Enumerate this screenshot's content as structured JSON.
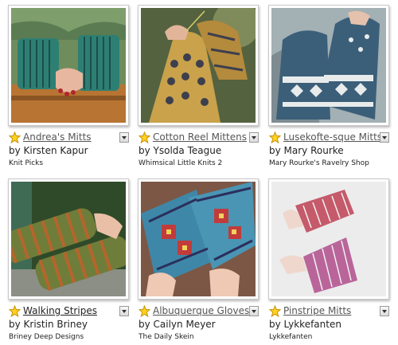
{
  "patterns": [
    {
      "title": "Andrea's Mitts",
      "author": "by Kirsten Kapur",
      "source": "Knit Picks",
      "image_alt": "green striped fingerless mitts",
      "colors": {
        "bg": "#6b7e58",
        "knit": "#2e7f73",
        "stripe": "#1c4e4a",
        "skin": "#e7b7a0"
      }
    },
    {
      "title": "Cotton Reel Mittens",
      "author": "by Ysolda Teague",
      "source": "Whimsical Little Knits 2",
      "image_alt": "mustard and grey colorwork mittens",
      "colors": {
        "bg": "#4f5e3d",
        "knit": "#c9a24b",
        "stripe": "#3d3f4e",
        "skin": "#e2b59a"
      }
    },
    {
      "title": "Lusekofte-sque Mitts",
      "author": "by Mary Rourke",
      "source": "Mary Rourke's Ravelry Shop",
      "image_alt": "blue and white patterned mitts",
      "colors": {
        "bg": "#9aa9ae",
        "knit": "#3c5f79",
        "stripe": "#e8ebec",
        "skin": "#e5c2ad"
      }
    },
    {
      "title": "Walking Stripes",
      "author": "by Kristin Briney",
      "source": "Briney Deep Designs",
      "image_alt": "olive and orange striped mitts",
      "colors": {
        "bg": "#37542e",
        "knit": "#6f7d3a",
        "stripe": "#b5652c",
        "skin": "#e9c0a6"
      }
    },
    {
      "title": "Albuquerque Gloves",
      "author": "by Cailyn Meyer",
      "source": "The Daily Skein",
      "image_alt": "multicolor southwestern motif gloves",
      "colors": {
        "bg": "#8a5f4d",
        "knit": "#3f87a8",
        "stripe": "#c23b3b",
        "skin": "#efc9b3"
      }
    },
    {
      "title": "Pinstripe Mitts",
      "author": "by Lykkefanten",
      "source": "Lykkefanten",
      "image_alt": "red pinstripe fingerless mitts",
      "colors": {
        "bg": "#ececec",
        "knit": "#c55a6a",
        "stripe": "#f2f2f2",
        "skin": "#efd7cd"
      }
    }
  ],
  "colors": {
    "star_fill": "#ffd31f",
    "star_stroke": "#c58d00",
    "title_hover": "#222222"
  },
  "icons": {
    "favorite": "star-icon",
    "menu": "dropdown-arrow-icon"
  }
}
